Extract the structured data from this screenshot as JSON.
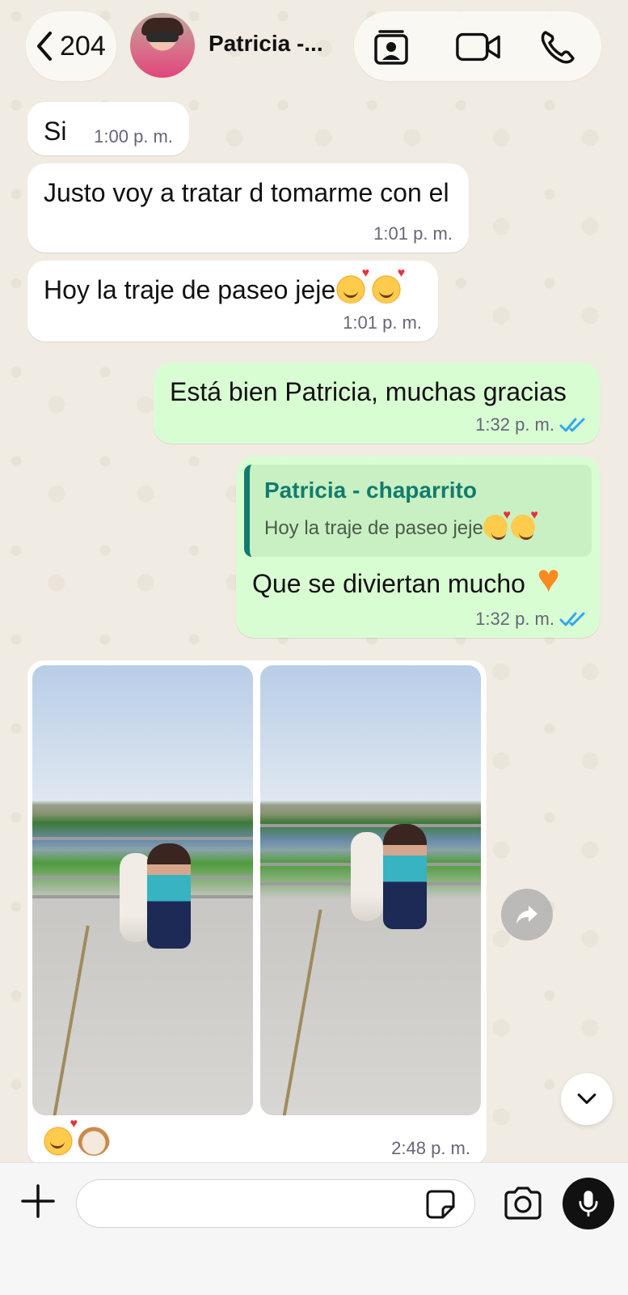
{
  "header": {
    "back_count": "204",
    "contact_name": "Patricia -...",
    "icons": [
      "chevron-left-icon",
      "contact-card-icon",
      "video-call-icon",
      "phone-icon"
    ]
  },
  "messages": [
    {
      "direction": "in",
      "text": "Si",
      "time": "1:00 p. m."
    },
    {
      "direction": "in",
      "text": "Justo voy a tratar d tomarme con el",
      "time": "1:01 p. m."
    },
    {
      "direction": "in",
      "text": "Hoy la traje de paseo jeje",
      "emojis": [
        "smiling-face-with-hearts",
        "smiling-face-with-hearts"
      ],
      "time": "1:01 p. m."
    },
    {
      "direction": "out",
      "text": "Está bien Patricia, muchas gracias",
      "time": "1:32 p. m.",
      "status": "read"
    },
    {
      "direction": "out",
      "reply_to": {
        "name": "Patricia - chaparrito",
        "text": "Hoy la traje de paseo jeje"
      },
      "text": "Que se diviertan mucho",
      "emojis": [
        "orange-heart"
      ],
      "time": "1:32 p. m.",
      "status": "read"
    },
    {
      "direction": "in",
      "type": "media",
      "photos": 2,
      "emojis": [
        "smiling-face-with-hearts",
        "dog-face"
      ],
      "time": "2:48 p. m."
    }
  ],
  "composer": {
    "value": "",
    "placeholder": ""
  },
  "colors": {
    "incoming": "#ffffff",
    "outgoing": "#d9fdd3",
    "read_ticks": "#34a7eb",
    "reply_accent": "#117c6e"
  }
}
